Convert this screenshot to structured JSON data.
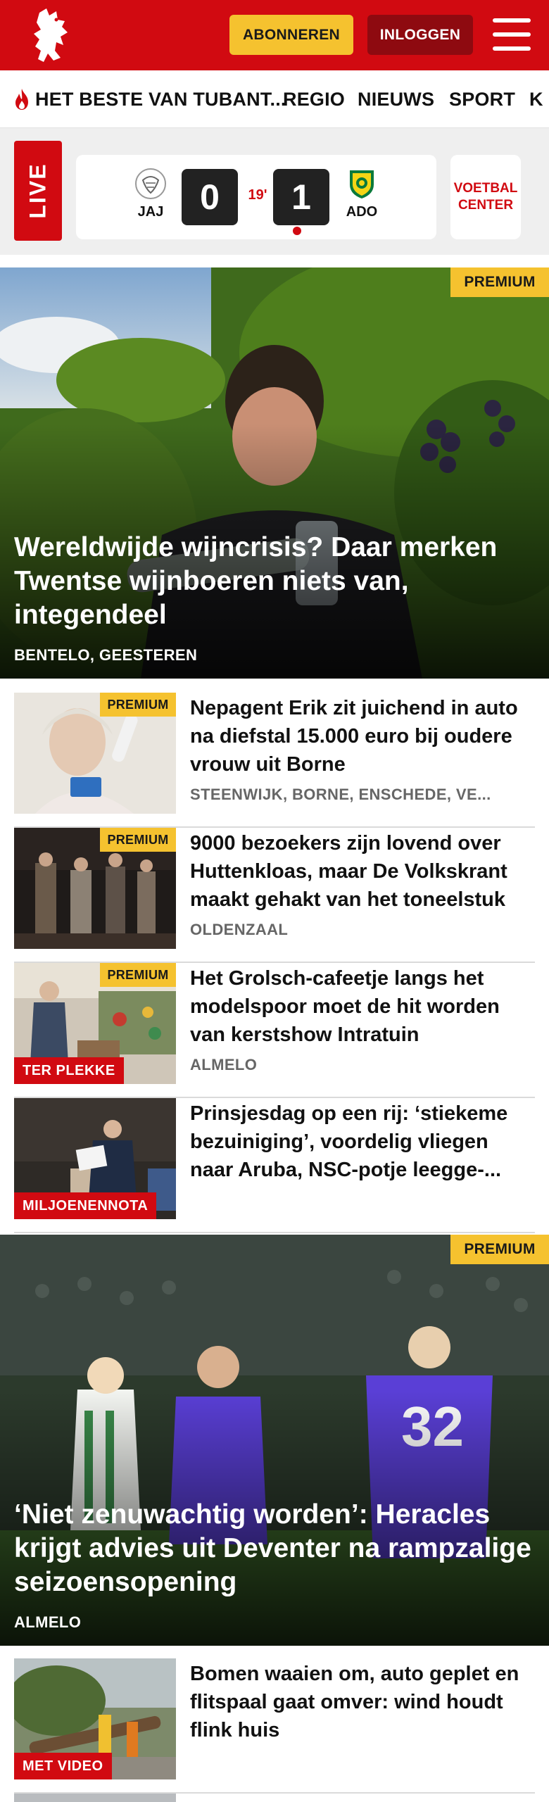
{
  "header": {
    "subscribe_label": "ABONNEREN",
    "login_label": "INLOGGEN",
    "brand_color": "#d10a11",
    "logo_icon": "tubantia-horse-logo",
    "menu_icon": "hamburger-menu-icon"
  },
  "nav": {
    "items": [
      {
        "label": "HET BESTE VAN TUBANT...",
        "icon": "flame-icon"
      },
      {
        "label": "REGIO"
      },
      {
        "label": "NIEUWS"
      },
      {
        "label": "SPORT"
      },
      {
        "label": "K"
      }
    ]
  },
  "live": {
    "badge": "LIVE",
    "home": {
      "abbr": "JAJ",
      "score": "0"
    },
    "away": {
      "abbr": "ADO",
      "score": "1"
    },
    "minute": "19'",
    "voetbal_center": "VOETBAL CENTER"
  },
  "premium_label": "PREMIUM",
  "hero1": {
    "title": "Wereldwijde wijncrisis? Daar merken Twentse wijnboeren niets van, integendeel",
    "location": "BENTELO, GEESTEREN",
    "premium": true
  },
  "articles": [
    {
      "title": "Nepagent Erik zit juichend in auto na diefstal 15.000 euro bij oudere vrouw uit Borne",
      "location": "STEENWIJK, BORNE, ENSCHEDE, VE...",
      "premium": true,
      "tag": ""
    },
    {
      "title": "9000 bezoekers zijn lovend over Huttenkloas, maar De Volkskrant maakt gehakt van het toneelstuk",
      "location": "OLDENZAAL",
      "premium": true,
      "tag": ""
    },
    {
      "title": "Het Grolsch-cafeetje langs het modelspoor moet de hit worden van kerstshow Intratuin",
      "location": "ALMELO",
      "premium": true,
      "tag": "TER PLEKKE"
    },
    {
      "title": "Prinsjesdag op een rij: ‘stiekeme bezuiniging’, voordelig vliegen naar Aruba, NSC-potje leegge-...",
      "location": "",
      "premium": false,
      "tag": "MILJOENENNOTA"
    }
  ],
  "hero2": {
    "title": "‘Niet zenuwachtig worden’: Heracles krijgt advies uit Deventer na rampzalige seizoensopening",
    "location": "ALMELO",
    "premium": true
  },
  "articles2": [
    {
      "title": "Bomen waaien om, auto geplet en flitspaal gaat omver: wind houdt flink huis",
      "location": "",
      "premium": false,
      "tag": "MET VIDEO"
    }
  ]
}
